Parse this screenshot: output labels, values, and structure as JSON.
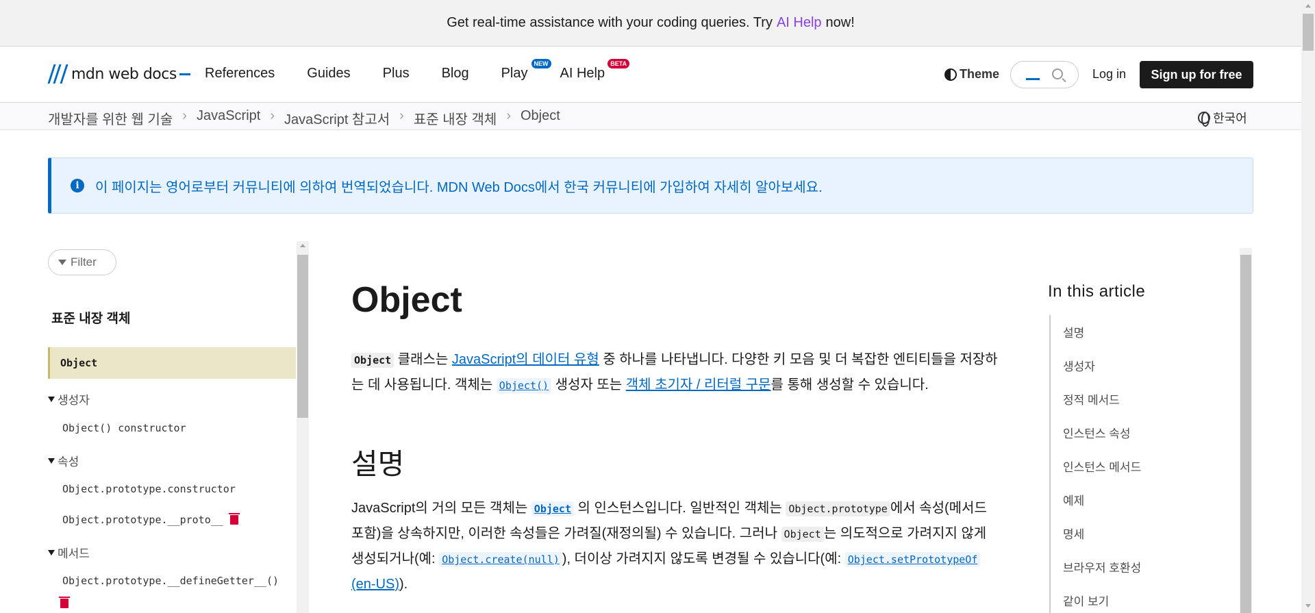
{
  "banner": {
    "text_before": "Get real-time assistance with your coding queries. Try",
    "link": "AI Help",
    "text_after": "now!"
  },
  "header": {
    "logo_text": "mdn web docs",
    "nav": [
      "References",
      "Guides",
      "Plus",
      "Blog",
      "Play",
      "AI Help"
    ],
    "play_tag": "NEW",
    "aihelp_tag": "BETA",
    "theme_label": "Theme",
    "login_label": "Log in",
    "signup_label": "Sign up for free"
  },
  "breadcrumb": {
    "items": [
      "개발자를 위한 웹 기술",
      "JavaScript",
      "JavaScript 참고서",
      "표준 내장 객체",
      "Object"
    ],
    "separator": "›",
    "language": "한국어"
  },
  "notice": {
    "icon": "i",
    "text": "이 페이지는 영어로부터 커뮤니티에 의하여 번역되었습니다. MDN Web Docs에서 한국 커뮤니티에 가입하여 자세히 알아보세요."
  },
  "sidebar": {
    "filter_label": "Filter",
    "title": "표준 내장 객체",
    "active": "Object",
    "group_constructor": "생성자",
    "constructor_item": "Object() constructor",
    "group_props": "속성",
    "prop_items": [
      "Object.prototype.constructor",
      "Object.prototype.__proto__"
    ],
    "group_methods": "메서드",
    "method_items": [
      "Object.prototype.__defineGetter__()"
    ]
  },
  "article": {
    "title": "Object",
    "p1": {
      "code1": "Object",
      "t1": " 클래스는 ",
      "link1": "JavaScript의 데이터 유형",
      "t2": " 중 하나를 나타냅니다. 다양한 키 모음 및 더 복잡한 엔티티들을 저장하는 데 사용됩니다. 객체는 ",
      "code2": "Object()",
      "t3": " 생성자 또는 ",
      "link2": "객체 초기자 / 리터럴 구문",
      "t4": "를 통해 생성할 수 있습니다."
    },
    "h2": "설명",
    "p2": {
      "t1": "JavaScript의 거의 모든 객체는 ",
      "code1": "Object",
      "t2": " 의 인스턴스입니다. 일반적인 객체는 ",
      "code2": "Object.prototype",
      "t3": "에서 속성(메서드 포함)을 상속하지만, 이러한 속성들은 가려질(재정의될) 수 있습니다. 그러나 ",
      "code3": "Object",
      "t4": "는 의도적으로 가려지지 않게 생성되거나(예: ",
      "code4": "Object.create(null)",
      "t5": "), 더이상 가려지지 않도록 변경될 수 있습니다(예: ",
      "code5": "Object.setPrototypeOf",
      "link5": " (en-US)",
      "t6": ")."
    }
  },
  "toc": {
    "title": "In this article",
    "items": [
      "설명",
      "생성자",
      "정적 메서드",
      "인스턴스 속성",
      "인스턴스 메서드",
      "예제",
      "명세",
      "브라우저 호환성",
      "같이 보기"
    ]
  },
  "colors": {
    "accent": "#0069c2",
    "ai_purple": "#8a41e0",
    "deprecated_red": "#d30038",
    "active_item_bg": "#ece6c8"
  }
}
